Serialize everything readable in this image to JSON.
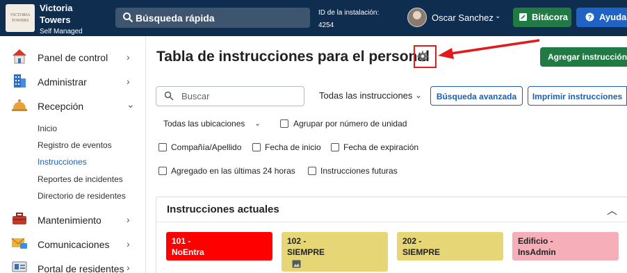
{
  "header": {
    "logo_text": "VICTORIA TOWERS",
    "brand_name": "Victoria Towers",
    "brand_sub": "Self Managed",
    "search_label": "Búsqueda rápida",
    "installation_label": "ID de la instalación:",
    "installation_id": "4254",
    "user_name": "Oscar Sanchez",
    "bitacora_label": "Bitácora",
    "ayuda_label": "Ayuda"
  },
  "sidebar": {
    "items": [
      {
        "label": "Panel de control",
        "icon": "house-icon"
      },
      {
        "label": "Administrar",
        "icon": "building-icon"
      },
      {
        "label": "Recepción",
        "icon": "bell-icon"
      },
      {
        "label": "Mantenimiento",
        "icon": "toolbox-icon"
      },
      {
        "label": "Comunicaciones",
        "icon": "envelope-icon"
      },
      {
        "label": "Portal de residentes",
        "icon": "portal-icon"
      }
    ],
    "reception_sub": [
      "Inicio",
      "Registro de eventos",
      "Instrucciones",
      "Reportes de incidentes",
      "Directorio de residentes"
    ],
    "active_sub": "Instrucciones"
  },
  "main": {
    "title": "Tabla de instrucciones para el personal",
    "add_button": "Agregar instrucción",
    "search_placeholder": "Buscar",
    "filter_all": "Todas las instrucciones",
    "advanced_search": "Búsqueda avanzada",
    "print_button": "Imprimir instrucciones",
    "locations_filter": "Todas las ubicaciones",
    "checkboxes": {
      "group_unit": "Agrupar por número de unidad",
      "company": "Compañía/Apellido",
      "start_date": "Fecha de inicio",
      "expiry_date": "Fecha de expiración",
      "last24": "Agregado en las últimas 24 horas",
      "future": "Instrucciones futuras"
    },
    "panel_title": "Instrucciones actuales",
    "cards": [
      {
        "line1": "101 -",
        "line2": "NoEntra",
        "color": "#ff0000"
      },
      {
        "line1": "102 -",
        "line2": "SIEMPRE",
        "color": "#e6d675"
      },
      {
        "line1": "202 -",
        "line2": "SIEMPRE",
        "color": "#e6d675"
      },
      {
        "line1": "Edificio -",
        "line2": "InsAdmin",
        "color": "#f6aeb9"
      }
    ]
  },
  "colors": {
    "topbar": "#0f2d4e",
    "green": "#1f7a43",
    "blue": "#1e63c5",
    "annotation_red": "#e11b1b"
  }
}
